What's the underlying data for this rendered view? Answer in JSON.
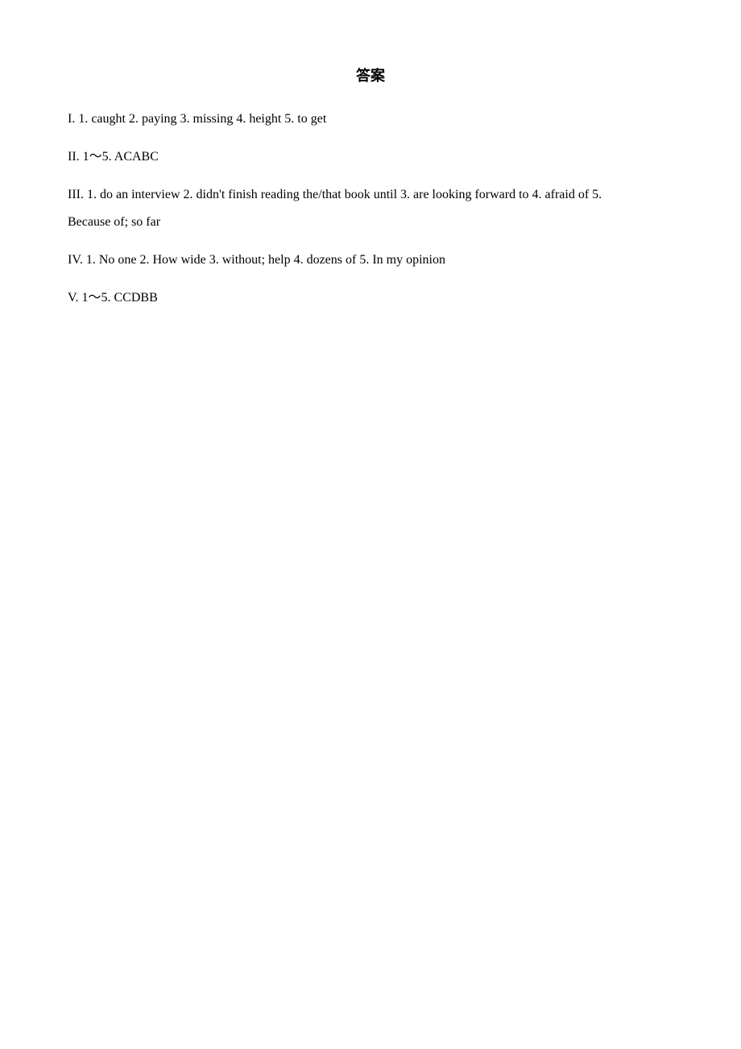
{
  "page": {
    "title": "答案",
    "sections": [
      {
        "id": "section-I",
        "label": "I.",
        "content": "1. caught    2. paying    3. missing    4. height    5. to get"
      },
      {
        "id": "section-II",
        "label": "II.",
        "content": "1～5. ACABC"
      },
      {
        "id": "section-III",
        "label": "III.",
        "line1": "1. do an interview    2. didn't finish reading the/that book until    3. are looking forward to    4. afraid of    5.",
        "line2": "Because of; so far"
      },
      {
        "id": "section-IV",
        "label": "IV.",
        "content": "1. No one    2. How wide    3. without; help    4. dozens of    5. In my opinion"
      },
      {
        "id": "section-V",
        "label": "V.",
        "content": "1～5. CCDBB"
      }
    ]
  }
}
